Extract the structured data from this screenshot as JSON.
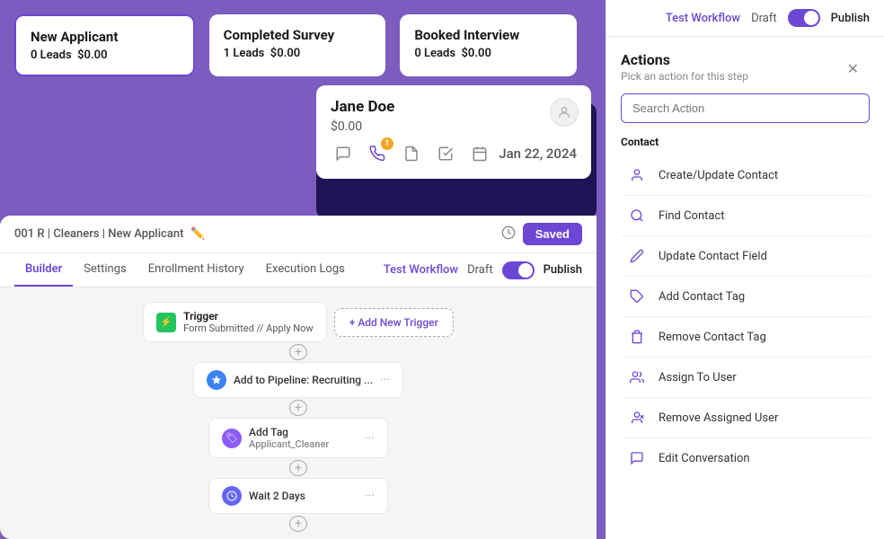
{
  "pipeline": {
    "cards": [
      {
        "title": "New Applicant",
        "leads": "0 Leads",
        "amount": "$0.00",
        "active": true
      },
      {
        "title": "Completed Survey",
        "leads": "1 Leads",
        "amount": "$0.00",
        "active": false
      },
      {
        "title": "Booked Interview",
        "leads": "0 Leads",
        "amount": "$0.00",
        "active": false
      }
    ]
  },
  "contact": {
    "name": "Jane Doe",
    "amount": "$0.00",
    "date": "Jan 22, 2024"
  },
  "workflow": {
    "title": "001 R | Cleaners | New Applicant",
    "tabs": [
      "Builder",
      "Settings",
      "Enrollment History",
      "Execution Logs"
    ],
    "active_tab": "Builder",
    "test_workflow": "Test Workflow",
    "draft_label": "Draft",
    "publish_label": "Publish",
    "saved_label": "Saved",
    "trigger": {
      "label": "Trigger",
      "sublabel": "Form Submitted // Apply Now"
    },
    "add_trigger": "+ Add New Trigger",
    "steps": [
      {
        "icon_type": "blue",
        "icon_symbol": "⬡",
        "text": "Add to Pipeline: Recruiting ..."
      },
      {
        "icon_type": "purple",
        "icon_symbol": "🏷",
        "text": "Add Tag\nApplicant_Cleaner"
      },
      {
        "icon_type": "indigo",
        "icon_symbol": "⏱",
        "text": "Wait 2 Days"
      }
    ]
  },
  "actions_panel": {
    "title": "Actions",
    "subtitle": "Pick an action for this step",
    "search_placeholder": "Search Action",
    "section": "Contact",
    "items": [
      {
        "label": "Create/Update Contact",
        "icon": "👤"
      },
      {
        "label": "Find Contact",
        "icon": "🔍"
      },
      {
        "label": "Update Contact Field",
        "icon": "✏️"
      },
      {
        "label": "Add Contact Tag",
        "icon": "🏷"
      },
      {
        "label": "Remove Contact Tag",
        "icon": "🗑"
      },
      {
        "label": "Assign To User",
        "icon": "👥"
      },
      {
        "label": "Remove Assigned User",
        "icon": "👤"
      },
      {
        "label": "Edit Conversation",
        "icon": "💬"
      }
    ],
    "test_workflow": "Test Workflow",
    "draft_label": "Draft",
    "publish_label": "Publish"
  }
}
